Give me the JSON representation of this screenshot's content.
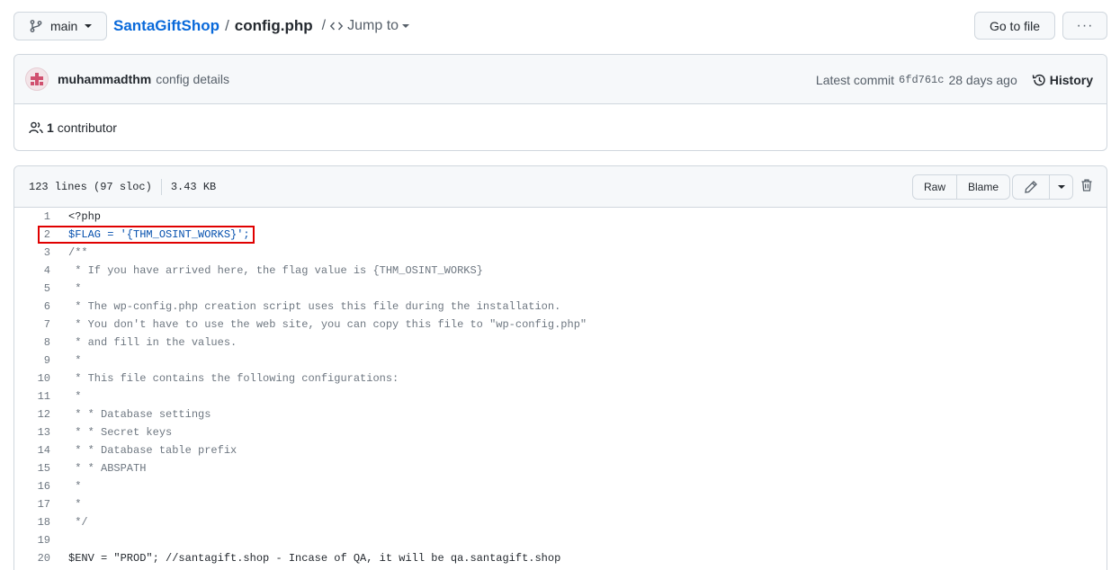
{
  "topbar": {
    "branch": "main",
    "repo": "SantaGiftShop",
    "separator": "/",
    "file": "config.php",
    "jump_slash": "/",
    "jump_label": "Jump to",
    "goto_file": "Go to file",
    "more": "···"
  },
  "commit": {
    "author": "muhammadthm",
    "message": "config details",
    "latest_label": "Latest commit",
    "sha": "6fd761c",
    "age": "28 days ago",
    "history_label": "History"
  },
  "contributors": {
    "count": "1",
    "label": "contributor"
  },
  "file": {
    "lines_info": "123 lines (97 sloc)",
    "size": "3.43 KB",
    "raw": "Raw",
    "blame": "Blame"
  },
  "code_lines": [
    {
      "n": "1",
      "text": "<?php"
    },
    {
      "n": "2",
      "text": "$FLAG = '{THM_OSINT_WORKS}';"
    },
    {
      "n": "3",
      "text": "/**"
    },
    {
      "n": "4",
      "text": " * If you have arrived here, the flag value is {THM_OSINT_WORKS}"
    },
    {
      "n": "5",
      "text": " *"
    },
    {
      "n": "6",
      "text": " * The wp-config.php creation script uses this file during the installation."
    },
    {
      "n": "7",
      "text": " * You don't have to use the web site, you can copy this file to \"wp-config.php\""
    },
    {
      "n": "8",
      "text": " * and fill in the values."
    },
    {
      "n": "9",
      "text": " *"
    },
    {
      "n": "10",
      "text": " * This file contains the following configurations:"
    },
    {
      "n": "11",
      "text": " *"
    },
    {
      "n": "12",
      "text": " * * Database settings"
    },
    {
      "n": "13",
      "text": " * * Secret keys"
    },
    {
      "n": "14",
      "text": " * * Database table prefix"
    },
    {
      "n": "15",
      "text": " * * ABSPATH"
    },
    {
      "n": "16",
      "text": " *"
    },
    {
      "n": "17",
      "text": " *"
    },
    {
      "n": "18",
      "text": " */"
    },
    {
      "n": "19",
      "text": ""
    },
    {
      "n": "20",
      "text": "$ENV = \"PROD\"; //santagift.shop - Incase of QA, it will be qa.santagift.shop"
    }
  ],
  "colors": {
    "link": "#0969da",
    "highlight_border": "#e00000",
    "comment": "#6e7781",
    "variable": "#0550ae",
    "string": "#0a3069"
  }
}
